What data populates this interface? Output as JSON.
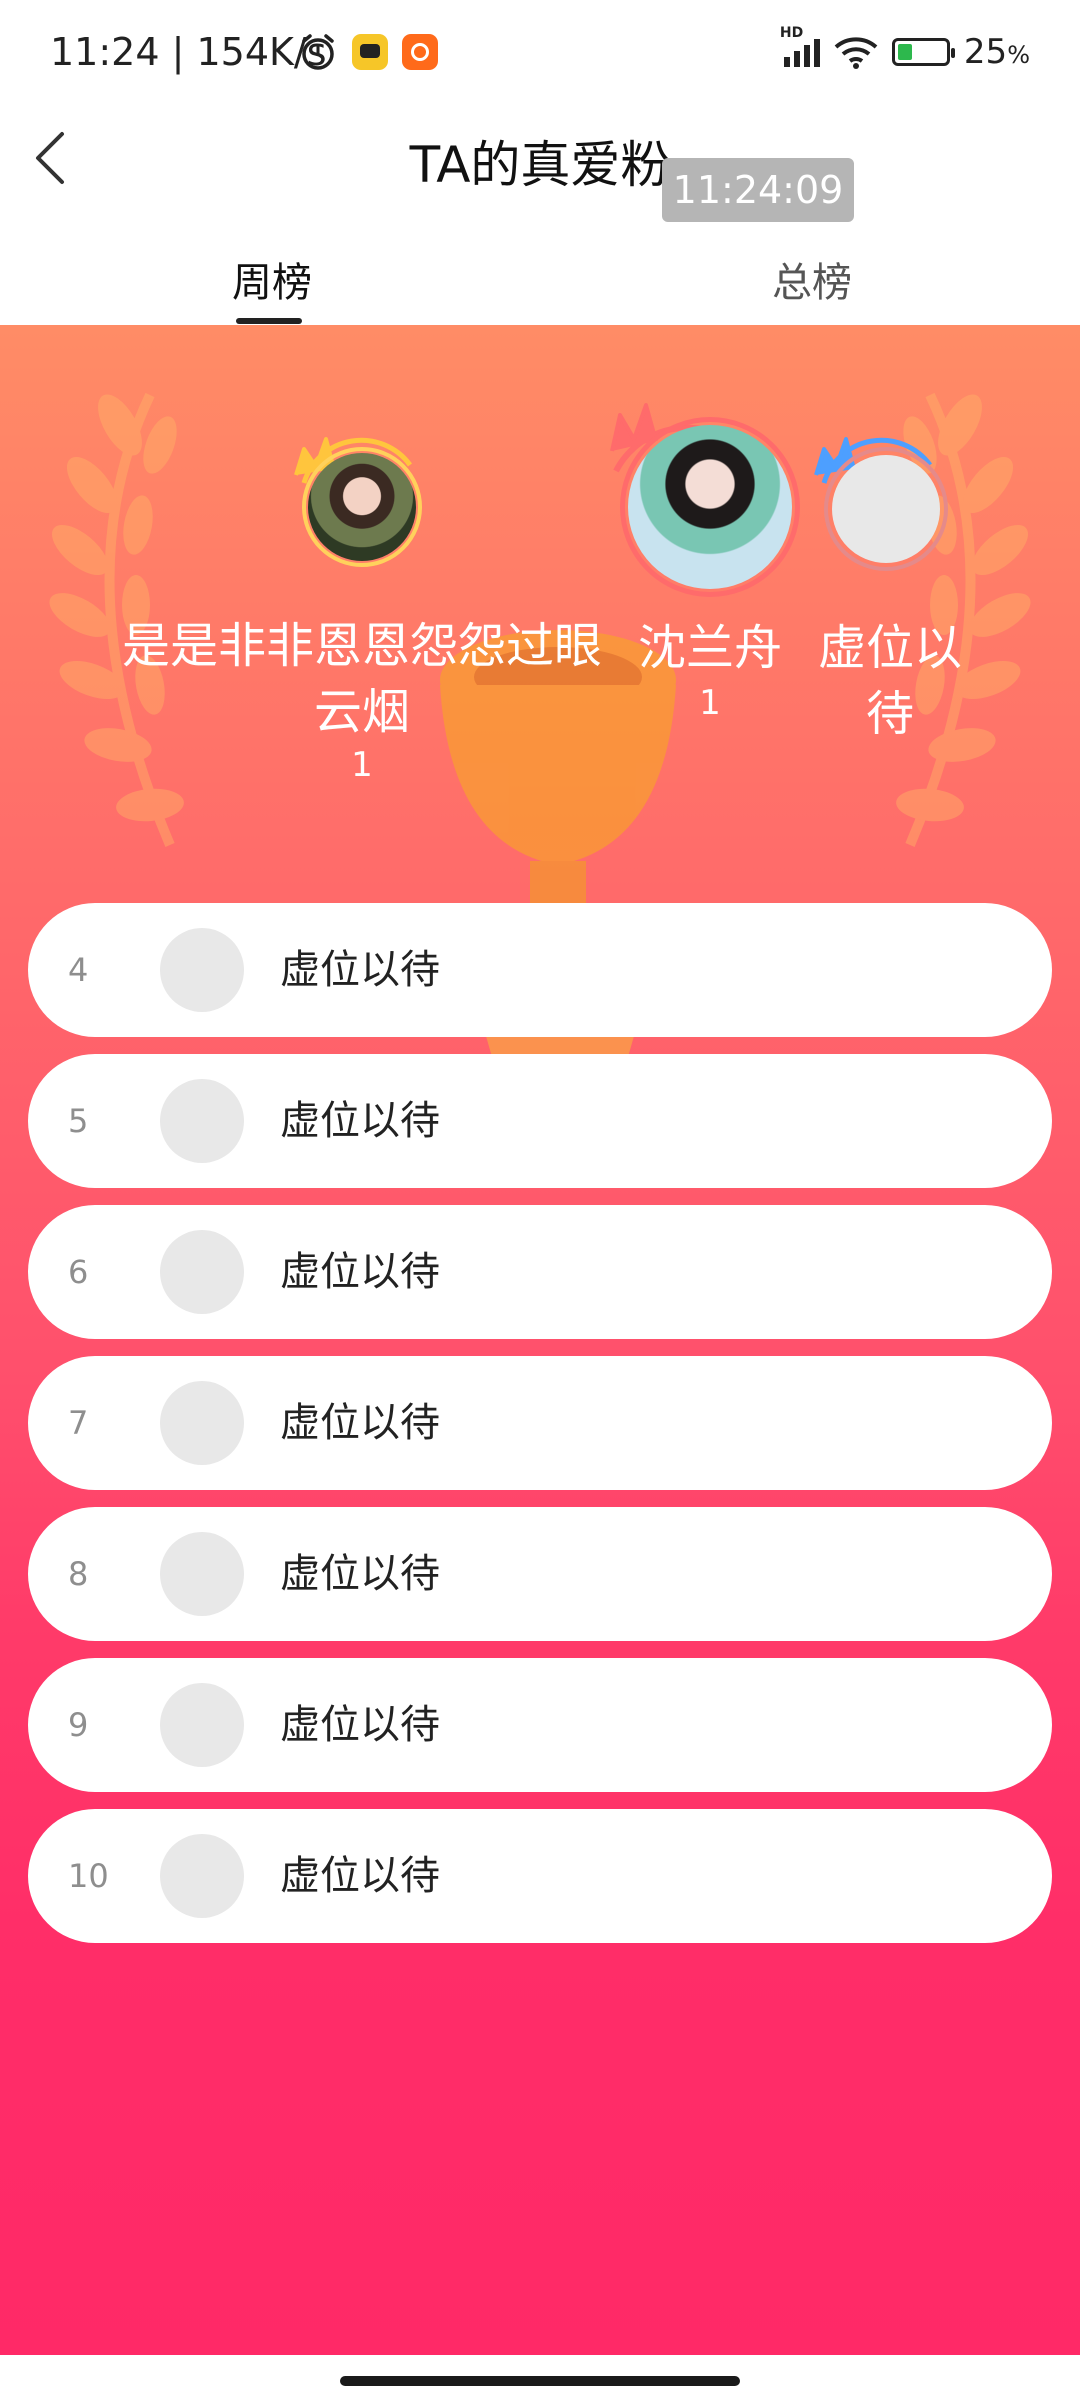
{
  "status_bar": {
    "time": "11:24 | 154K/s",
    "battery_percent": "25",
    "battery_unit": "%",
    "signal_label": "HD",
    "icons": [
      "alarm-icon",
      "app-icon-yellow",
      "app-icon-orange",
      "signal-icon",
      "wifi-icon",
      "battery-icon"
    ]
  },
  "header": {
    "title": "TA的真爱粉",
    "time_overlay": "11:24:09",
    "back_icon": "chevron-left-icon"
  },
  "tabs": [
    {
      "label": "周榜",
      "active": true
    },
    {
      "label": "总榜",
      "active": false
    }
  ],
  "podium": {
    "left": {
      "name_line1": "是是非非恩恩怨怨过眼",
      "name_line2": "云烟",
      "score": "1",
      "ring_color": "#ffc53d"
    },
    "center": {
      "name": "沈兰舟",
      "score": "1",
      "ring_color": "#ff6b6b"
    },
    "right": {
      "name_line1": "虚位以",
      "name_line2": "待",
      "ring_color": "#4d9fff"
    }
  },
  "list": [
    {
      "rank": "4",
      "name": "虚位以待"
    },
    {
      "rank": "5",
      "name": "虚位以待"
    },
    {
      "rank": "6",
      "name": "虚位以待"
    },
    {
      "rank": "7",
      "name": "虚位以待"
    },
    {
      "rank": "8",
      "name": "虚位以待"
    },
    {
      "rank": "9",
      "name": "虚位以待"
    },
    {
      "rank": "10",
      "name": "虚位以待"
    }
  ],
  "colors": {
    "panel_top": "#ff8c66",
    "panel_bottom": "#ff2967",
    "placeholder_avatar": "#e8e8e8"
  }
}
